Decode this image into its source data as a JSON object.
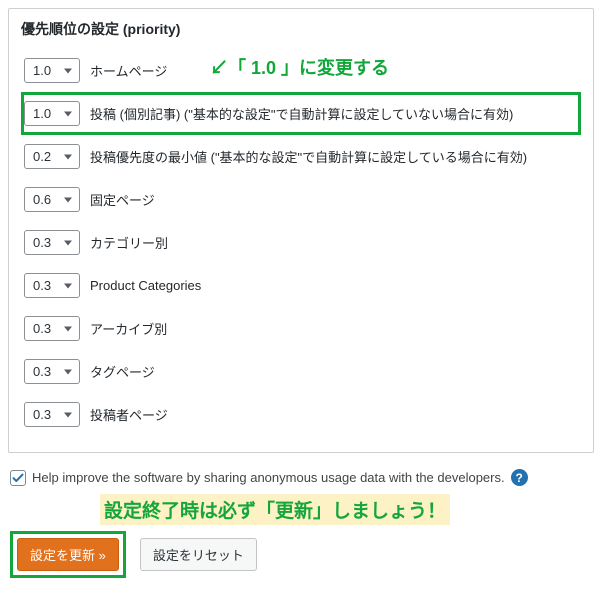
{
  "panel": {
    "title": "優先順位の設定 (priority)"
  },
  "rows": [
    {
      "value": "1.0",
      "label": "ホームページ",
      "highlight": false
    },
    {
      "value": "1.0",
      "label": "投稿 (個別記事) (\"基本的な設定\"で自動計算に設定していない場合に有効)",
      "highlight": true
    },
    {
      "value": "0.2",
      "label": "投稿優先度の最小値 (\"基本的な設定\"で自動計算に設定している場合に有効)",
      "highlight": false
    },
    {
      "value": "0.6",
      "label": "固定ページ",
      "highlight": false
    },
    {
      "value": "0.3",
      "label": "カテゴリー別",
      "highlight": false
    },
    {
      "value": "0.3",
      "label": "Product Categories",
      "highlight": false
    },
    {
      "value": "0.3",
      "label": "アーカイブ別",
      "highlight": false
    },
    {
      "value": "0.3",
      "label": "タグページ",
      "highlight": false
    },
    {
      "value": "0.3",
      "label": "投稿者ページ",
      "highlight": false
    }
  ],
  "annotation1": "↙「 1.0 」に変更する",
  "checkbox": {
    "checked": true,
    "label": "Help improve the software by sharing anonymous usage data with the developers."
  },
  "annotation2": "設定終了時は必ず「更新」しましょう！",
  "buttons": {
    "primary": "設定を更新 »",
    "secondary": "設定をリセット"
  }
}
